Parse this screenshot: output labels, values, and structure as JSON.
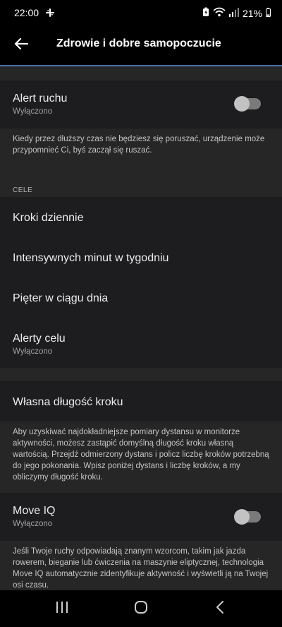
{
  "status_bar": {
    "time": "22:00",
    "battery_percent": "21%",
    "icons": [
      "slack-icon",
      "battery-saver-icon",
      "wifi-icon",
      "signal-icon",
      "battery-icon"
    ]
  },
  "header": {
    "title": "Zdrowie i dobre samopoczucie",
    "back_icon": "arrow-left-icon"
  },
  "move_alert": {
    "title": "Alert ruchu",
    "status": "Wyłączono",
    "enabled": false,
    "description": "Kiedy przez dłuższy czas nie będziesz się poruszać, urządzenie może przypomnieć Ci, byś zaczął się ruszać."
  },
  "goals": {
    "header": "CELE",
    "items": [
      {
        "title": "Kroki dziennie"
      },
      {
        "title": "Intensywnych minut w tygodniu"
      },
      {
        "title": "Pięter w ciągu dnia"
      },
      {
        "title": "Alerty celu",
        "status": "Wyłączono"
      }
    ]
  },
  "stride": {
    "title": "Własna długość kroku",
    "description": "Aby uzyskiwać najdokładniejsze pomiary dystansu w monitorze aktywności, możesz zastąpić domyślną długość kroku własną wartością. Przejdź odmierzony dystans i policz liczbę kroków potrzebną do jego pokonania. Wpisz poniżej dystans i liczbę kroków, a my obliczymy długość kroku."
  },
  "move_iq": {
    "title": "Move IQ",
    "status": "Wyłączono",
    "enabled": false,
    "description": "Jeśli Twoje ruchy odpowiadają znanym wzorcom, takim jak jazda rowerem, bieganie lub ćwiczenia na maszynie eliptycznej, technologia Move IQ automatycznie zidentyfikuje aktywność i wyświetli ją na Twojej osi czasu."
  },
  "nav": {
    "icons": [
      "recent-apps-icon",
      "home-icon",
      "back-icon"
    ]
  }
}
